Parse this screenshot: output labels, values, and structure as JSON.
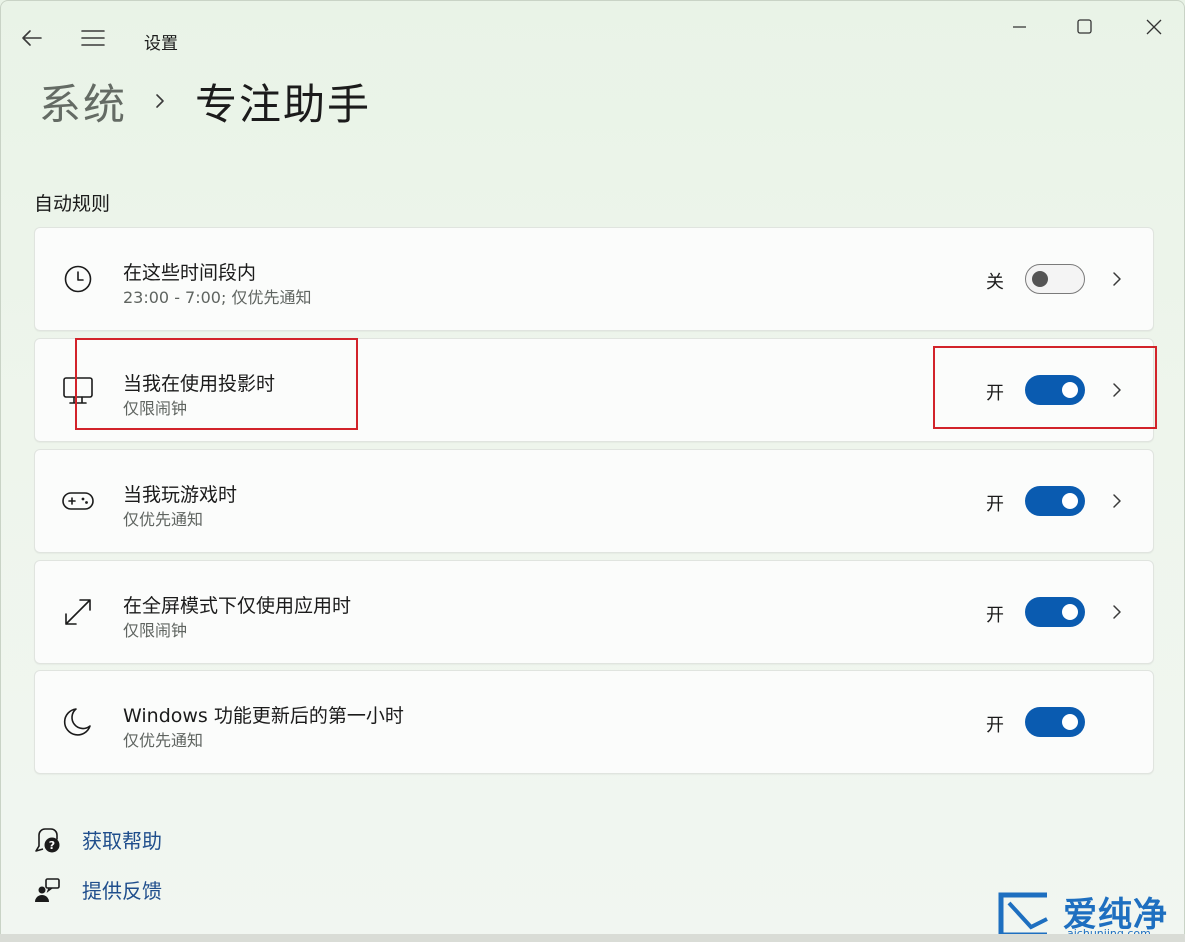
{
  "window": {
    "title": "设置"
  },
  "breadcrumb": {
    "parent": "系统",
    "current": "专注助手"
  },
  "section": {
    "title": "自动规则"
  },
  "rules": [
    {
      "title": "在这些时间段内",
      "subtitle": "23:00 - 7:00; 仅优先通知",
      "state_label": "关",
      "on": false,
      "icon": "clock-icon",
      "has_chevron": true
    },
    {
      "title": "当我在使用投影时",
      "subtitle": "仅限闹钟",
      "state_label": "开",
      "on": true,
      "icon": "monitor-icon",
      "has_chevron": true
    },
    {
      "title": "当我玩游戏时",
      "subtitle": "仅优先通知",
      "state_label": "开",
      "on": true,
      "icon": "gamepad-icon",
      "has_chevron": true
    },
    {
      "title": "在全屏模式下仅使用应用时",
      "subtitle": "仅限闹钟",
      "state_label": "开",
      "on": true,
      "icon": "fullscreen-arrows-icon",
      "has_chevron": true
    },
    {
      "title": "Windows 功能更新后的第一小时",
      "subtitle": "仅优先通知",
      "state_label": "开",
      "on": true,
      "icon": "moon-icon",
      "has_chevron": false
    }
  ],
  "links": {
    "help": "获取帮助",
    "feedback": "提供反馈"
  },
  "watermark": {
    "title": "爱纯净",
    "url": "aichunjing.com"
  },
  "colors": {
    "accent": "#0a5bb0",
    "highlight": "#d2232a",
    "link": "#1f4e8c"
  }
}
